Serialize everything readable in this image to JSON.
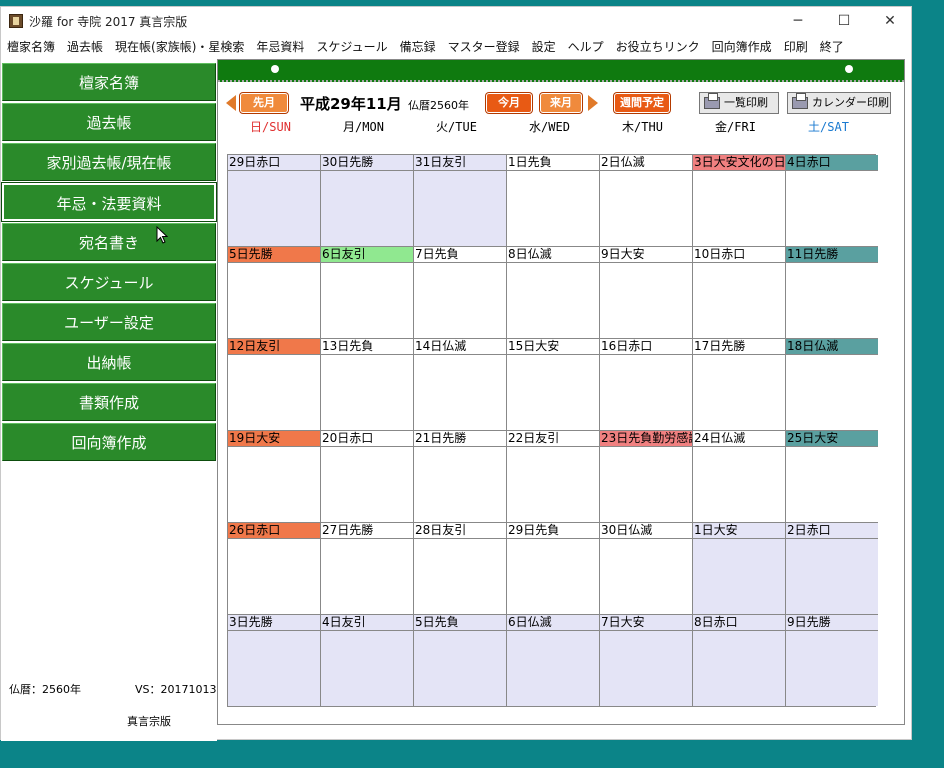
{
  "window": {
    "title": "沙羅 for 寺院 2017 真言宗版"
  },
  "menu": [
    "檀家名簿",
    "過去帳",
    "現在帳(家族帳)・星検索",
    "年忌資料",
    "スケジュール",
    "備忘録",
    "マスター登録",
    "設定",
    "ヘルプ",
    "お役立ちリンク",
    "回向簿作成",
    "印刷",
    "終了"
  ],
  "sidebar": {
    "items": [
      "檀家名簿",
      "過去帳",
      "家別過去帳/現在帳",
      "年忌・法要資料",
      "宛名書き",
      "スケジュール",
      "ユーザー設定",
      "出納帳",
      "書類作成",
      "回向簿作成"
    ],
    "selected_index": 3,
    "footer": {
      "bukki": "仏暦：2560年",
      "version": "VS：20171013",
      "edition": "真言宗版"
    }
  },
  "toolbar": {
    "prev_label": "先月",
    "month_title": "平成29年11月",
    "bukki": "仏暦2560年",
    "today_label": "今月",
    "next_label": "来月",
    "week_label": "週間予定",
    "list_print_label": "一覧印刷",
    "calendar_print_label": "カレンダー印刷"
  },
  "weekdays": [
    "日/SUN",
    "月/MON",
    "火/TUE",
    "水/WED",
    "木/THU",
    "金/FRI",
    "土/SAT"
  ],
  "colors": {
    "sun": "#e03030",
    "sat": "#1a7ad0",
    "weekday": "#000000"
  },
  "calendar": {
    "weeks": [
      [
        {
          "label": "29日赤口",
          "dim": true
        },
        {
          "label": "30日先勝",
          "dim": true
        },
        {
          "label": "31日友引",
          "dim": true
        },
        {
          "label": "1日先負"
        },
        {
          "label": "2日仏滅"
        },
        {
          "label": "3日大安文化の日",
          "hl": "hol"
        },
        {
          "label": "4日赤口",
          "hl": "sat"
        }
      ],
      [
        {
          "label": "5日先勝",
          "hl": "sun"
        },
        {
          "label": "6日友引",
          "hl": "green"
        },
        {
          "label": "7日先負"
        },
        {
          "label": "8日仏滅"
        },
        {
          "label": "9日大安"
        },
        {
          "label": "10日赤口"
        },
        {
          "label": "11日先勝",
          "hl": "sat"
        }
      ],
      [
        {
          "label": "12日友引",
          "hl": "sun"
        },
        {
          "label": "13日先負"
        },
        {
          "label": "14日仏滅"
        },
        {
          "label": "15日大安"
        },
        {
          "label": "16日赤口"
        },
        {
          "label": "17日先勝"
        },
        {
          "label": "18日仏滅",
          "hl": "sat"
        }
      ],
      [
        {
          "label": "19日大安",
          "hl": "sun"
        },
        {
          "label": "20日赤口"
        },
        {
          "label": "21日先勝"
        },
        {
          "label": "22日友引"
        },
        {
          "label": "23日先負勤労感謝の日",
          "hl": "hol"
        },
        {
          "label": "24日仏滅"
        },
        {
          "label": "25日大安",
          "hl": "sat"
        }
      ],
      [
        {
          "label": "26日赤口",
          "hl": "sun"
        },
        {
          "label": "27日先勝"
        },
        {
          "label": "28日友引"
        },
        {
          "label": "29日先負"
        },
        {
          "label": "30日仏滅"
        },
        {
          "label": "1日大安",
          "dim": true
        },
        {
          "label": "2日赤口",
          "dim": true
        }
      ],
      [
        {
          "label": "3日先勝",
          "dim": true
        },
        {
          "label": "4日友引",
          "dim": true
        },
        {
          "label": "5日先負",
          "dim": true
        },
        {
          "label": "6日仏滅",
          "dim": true
        },
        {
          "label": "7日大安",
          "dim": true
        },
        {
          "label": "8日赤口",
          "dim": true
        },
        {
          "label": "9日先勝",
          "dim": true
        }
      ]
    ]
  }
}
